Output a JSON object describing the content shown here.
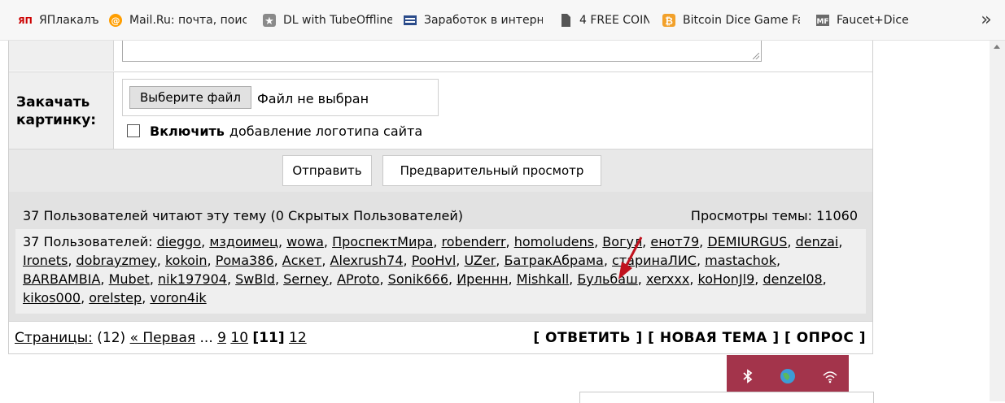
{
  "bookmarks": {
    "items": [
      {
        "label": "ЯПлакалъ",
        "icon": "yaplakal-icon"
      },
      {
        "label": "Mail.Ru: почта, поиск",
        "icon": "mailru-icon"
      },
      {
        "label": "DL with TubeOffline",
        "icon": "star-icon"
      },
      {
        "label": "Заработок в интерне",
        "icon": "site-icon"
      },
      {
        "label": "4 FREE COIN",
        "icon": "page-icon"
      },
      {
        "label": "Bitcoin Dice Game Fa",
        "icon": "bitcoin-icon"
      },
      {
        "label": "Faucet+Dice",
        "icon": "site-icon"
      }
    ],
    "more": "»"
  },
  "form": {
    "upload_label": "Закачать картинку:",
    "file_button": "Выберите файл",
    "file_status": "Файл не выбран",
    "logo_checkbox_bold": "Включить",
    "logo_checkbox_text": "добавление логотипа сайта",
    "submit_button": "Отправить",
    "preview_button": "Предварительный просмотр"
  },
  "readers": {
    "summary": "37 Пользователей читают эту тему (0 Скрытых Пользователей)",
    "views": "Просмотры темы: 11060",
    "users_prefix": "37 Пользователей:",
    "users": [
      "dieggo",
      "мздоимец",
      "wowa",
      "ПроспектМира",
      "robenderr",
      "homoludens",
      "Вогул",
      "енот79",
      "DEMIURGUS",
      "denzai",
      "Ironets",
      "dobrayzmey",
      "kokoin",
      "Рома386",
      "Аскет",
      "Alexrush74",
      "PooHvl",
      "UZer",
      "БатракАбрама",
      "старинаЛИС",
      "mastachok",
      "BARBAMBIA",
      "Mubet",
      "nik197904",
      "SwBld",
      "Serney",
      "AProto",
      "Sonik666",
      "Иреннн",
      "Mishkall",
      "Бульбаш",
      "xerxxx",
      "koHonJl9",
      "denzel08",
      "kikos000",
      "orelstep",
      "voron4ik"
    ]
  },
  "pagination": {
    "label": "Страницы:",
    "count": "(12)",
    "first": "« Первая",
    "ellipsis": "...",
    "pages": [
      "9",
      "10"
    ],
    "current": "[11]",
    "next": "12"
  },
  "actions": {
    "reply": "[ ОТВЕТИТЬ ]",
    "new_topic": "[ НОВАЯ ТЕМА ]",
    "poll": "[ ОПРОС ]"
  },
  "colors": {
    "tray": "#a3344b",
    "arrow": "#c0121e"
  }
}
